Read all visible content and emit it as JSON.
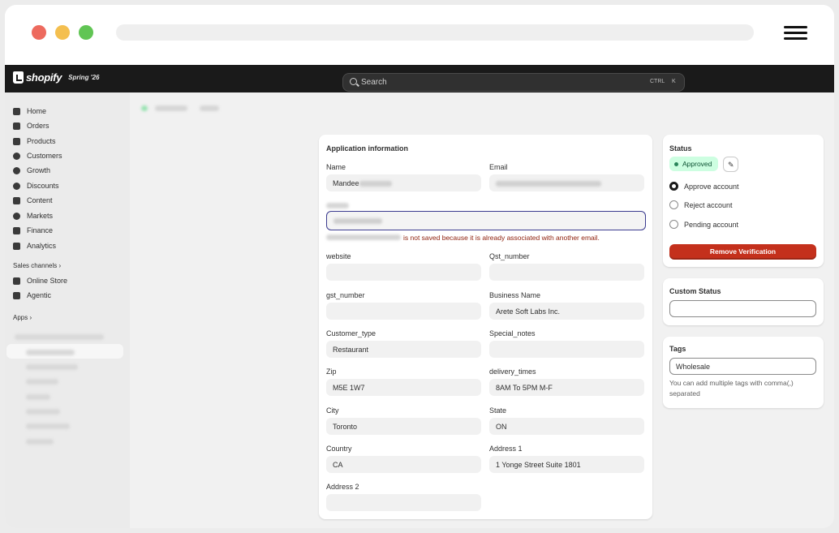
{
  "browser": {},
  "topbar": {
    "logo": "shopify",
    "edition": "Spring '26",
    "search_placeholder": "Search",
    "shortcut_mod": "CTRL",
    "shortcut_key": "K"
  },
  "sidebar": {
    "items": [
      {
        "label": "Home",
        "icon": "home-icon"
      },
      {
        "label": "Orders",
        "icon": "inbox-icon"
      },
      {
        "label": "Products",
        "icon": "tag-icon"
      },
      {
        "label": "Customers",
        "icon": "person-icon"
      },
      {
        "label": "Growth",
        "icon": "target-icon"
      },
      {
        "label": "Discounts",
        "icon": "discount-icon"
      },
      {
        "label": "Content",
        "icon": "content-icon"
      },
      {
        "label": "Markets",
        "icon": "globe-icon"
      },
      {
        "label": "Finance",
        "icon": "bank-icon"
      },
      {
        "label": "Analytics",
        "icon": "chart-bar-icon"
      }
    ],
    "sales_channels_label": "Sales channels",
    "channels": [
      {
        "label": "Online Store",
        "icon": "store-icon"
      },
      {
        "label": "Agentic",
        "icon": "agentic-icon"
      }
    ],
    "apps_label": "Apps"
  },
  "application": {
    "title": "Application information",
    "fields": {
      "name": {
        "label": "Name",
        "value": "Mandee"
      },
      "email": {
        "label": "Email",
        "value": ""
      },
      "error_message": "is not saved because it is already associated with another email.",
      "website": {
        "label": "website",
        "value": ""
      },
      "qst_number": {
        "label": "Qst_number",
        "value": ""
      },
      "gst_number": {
        "label": "gst_number",
        "value": ""
      },
      "business_name": {
        "label": "Business Name",
        "value": "Arete Soft Labs Inc."
      },
      "customer_type": {
        "label": "Customer_type",
        "value": "Restaurant"
      },
      "special_notes": {
        "label": "Special_notes",
        "value": ""
      },
      "zip": {
        "label": "Zip",
        "value": "M5E 1W7"
      },
      "delivery_times": {
        "label": "delivery_times",
        "value": "8AM To 5PM M-F"
      },
      "city": {
        "label": "City",
        "value": "Toronto"
      },
      "state": {
        "label": "State",
        "value": "ON"
      },
      "country": {
        "label": "Country",
        "value": "CA"
      },
      "address1": {
        "label": "Address 1",
        "value": "1 Yonge Street Suite 1801"
      },
      "address2": {
        "label": "Address 2",
        "value": ""
      }
    }
  },
  "status": {
    "title": "Status",
    "badge": "Approved",
    "options": [
      "Approve account",
      "Reject account",
      "Pending account"
    ],
    "selected": "Approve account",
    "remove_button": "Remove Verification"
  },
  "custom_status": {
    "title": "Custom Status",
    "value": ""
  },
  "tags": {
    "title": "Tags",
    "value": "Wholesale",
    "help": "You can add multiple tags with comma(,) separated"
  },
  "colors": {
    "topbar": "#1a1a1a",
    "badge_bg": "#cdfee1",
    "danger": "#c4301c",
    "error_text": "#8e1f0b",
    "focus_border": "#3b3b8f"
  }
}
